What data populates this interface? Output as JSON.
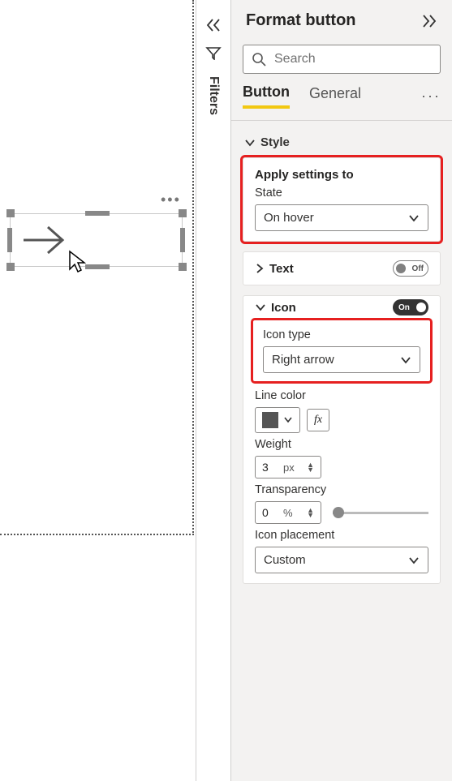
{
  "pane": {
    "title": "Format button",
    "search_placeholder": "Search",
    "tabs": {
      "button": "Button",
      "general": "General"
    }
  },
  "filters": {
    "label": "Filters"
  },
  "style": {
    "header": "Style",
    "apply_settings_to": "Apply settings to",
    "state_label": "State",
    "state_value": "On hover"
  },
  "text": {
    "header": "Text",
    "toggle_label": "Off"
  },
  "icon": {
    "header": "Icon",
    "toggle_label": "On",
    "type_label": "Icon type",
    "type_value": "Right arrow",
    "line_color_label": "Line color",
    "weight_label": "Weight",
    "weight_value": "3",
    "weight_unit": "px",
    "transparency_label": "Transparency",
    "transparency_value": "0",
    "transparency_unit": "%",
    "placement_label": "Icon placement",
    "placement_value": "Custom",
    "fx_label": "fx"
  }
}
